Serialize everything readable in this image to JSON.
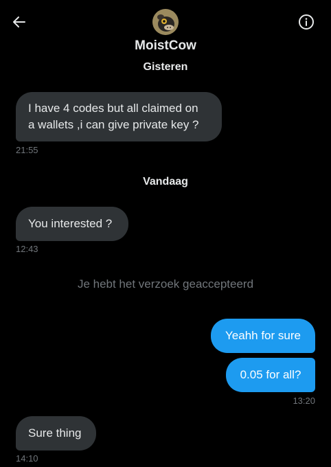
{
  "header": {
    "contact_name": "MoistCow",
    "back_icon": "arrow-left-icon",
    "info_icon": "info-circle-icon"
  },
  "colors": {
    "background": "#000000",
    "incoming_bubble": "#2f3336",
    "outgoing_bubble": "#1d9bf0",
    "timestamp": "#71767b"
  },
  "conversation": {
    "day1_label": "Gisteren",
    "msg1_line1": "I have 4 codes but all claimed on",
    "msg1_line2": "a wallets ,i can give private key ?",
    "msg1_time": "21:55",
    "day2_label": "Vandaag",
    "msg2_text": "You interested ?",
    "msg2_time": "12:43",
    "request_notice": "Je hebt het verzoek geaccepteerd",
    "msg3_text": "Yeahh for sure",
    "msg4_text": "0.05 for all?",
    "msg4_time": "13:20",
    "msg5_text": "Sure thing",
    "msg5_time": "14:10"
  }
}
